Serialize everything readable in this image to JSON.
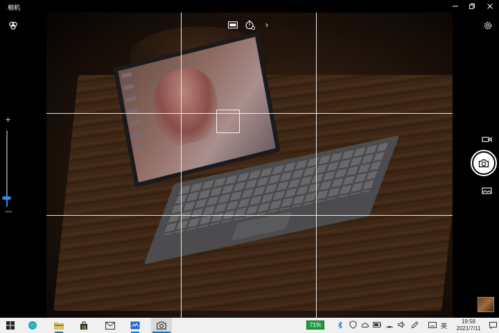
{
  "window": {
    "title": "相机"
  },
  "viewfinder": {
    "grid": "rule-of-thirds",
    "focus_indicator": "square"
  },
  "top_controls": {
    "hdr_icon": "hdr-icon",
    "timer_icon": "photo-timer-icon",
    "expand_label": "›"
  },
  "left_rail": {
    "settings_icon": "camera-settings-icon",
    "zoom_plus": "+",
    "zoom_minus": "—",
    "zoom_level": 0.1
  },
  "right_rail": {
    "settings_icon": "gear-icon",
    "video_mode_icon": "video-icon",
    "shutter_icon": "camera-icon",
    "pano_mode_icon": "panorama-icon"
  },
  "taskbar": {
    "apps": [
      "start",
      "edge",
      "file-explorer",
      "microsoft-store",
      "mail",
      "whiteboard",
      "camera"
    ],
    "battery_text": "71%",
    "ime_text": "英",
    "time": "19:58",
    "date": "2021/7/11",
    "accent": "#0078d7"
  }
}
